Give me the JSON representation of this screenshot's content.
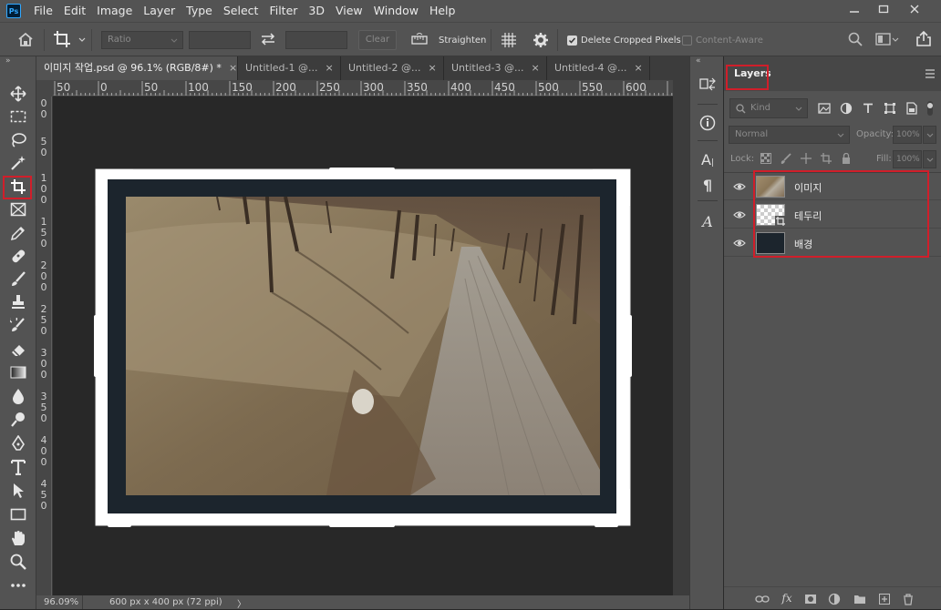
{
  "app": {
    "logo": "Ps",
    "menu": [
      "File",
      "Edit",
      "Image",
      "Layer",
      "Type",
      "Select",
      "Filter",
      "3D",
      "View",
      "Window",
      "Help"
    ]
  },
  "options": {
    "ratio_placeholder": "Ratio",
    "clear_label": "Clear",
    "straighten_label": "Straighten",
    "delete_cropped_label": "Delete Cropped Pixels",
    "delete_cropped_checked": true,
    "content_aware_label": "Content-Aware",
    "content_aware_checked": false
  },
  "tabs": [
    {
      "label": "이미지 작업.psd @ 96.1% (RGB/8#) *",
      "close": "×",
      "active": true
    },
    {
      "label": "Untitled-1 @...",
      "close": "×",
      "active": false
    },
    {
      "label": "Untitled-2 @...",
      "close": "×",
      "active": false
    },
    {
      "label": "Untitled-3 @...",
      "close": "×",
      "active": false
    },
    {
      "label": "Untitled-4 @...",
      "close": "×",
      "active": false
    }
  ],
  "rulers": {
    "h": [
      "50",
      "0",
      "50",
      "100",
      "150",
      "200",
      "250",
      "300",
      "350",
      "400",
      "450",
      "500",
      "550",
      "600"
    ],
    "v": [
      "0",
      "0",
      "5",
      "0",
      "1",
      "0",
      "0",
      "1",
      "5",
      "0",
      "2",
      "0",
      "0",
      "2",
      "5",
      "0",
      "3",
      "0",
      "0",
      "3",
      "5",
      "0",
      "4",
      "0",
      "0",
      "4",
      "5",
      "0"
    ]
  },
  "status": {
    "zoom": "96.09%",
    "doc_info": "600 px x 400 px (72 ppi)",
    "arrow": "〉"
  },
  "layers_panel": {
    "tab_label": "Layers",
    "filter_kind": "Kind",
    "blend_mode": "Normal",
    "opacity_label": "Opacity:",
    "opacity_value": "100%",
    "lock_label": "Lock:",
    "fill_label": "Fill:",
    "fill_value": "100%",
    "layers": [
      {
        "name": "이미지",
        "visible": true,
        "thumb": "photo"
      },
      {
        "name": "테두리",
        "visible": true,
        "thumb": "transparent"
      },
      {
        "name": "배경",
        "visible": true,
        "thumb": "dark"
      }
    ],
    "footer_fx": "fx"
  },
  "mid_panel": {
    "type_a": "A",
    "paragraph": "¶",
    "glyph_a": "A"
  },
  "colors": {
    "ui_bg": "#535353",
    "workspace": "#282828",
    "frame_dark": "#1c252d",
    "highlight_red": "#d01e2a"
  }
}
